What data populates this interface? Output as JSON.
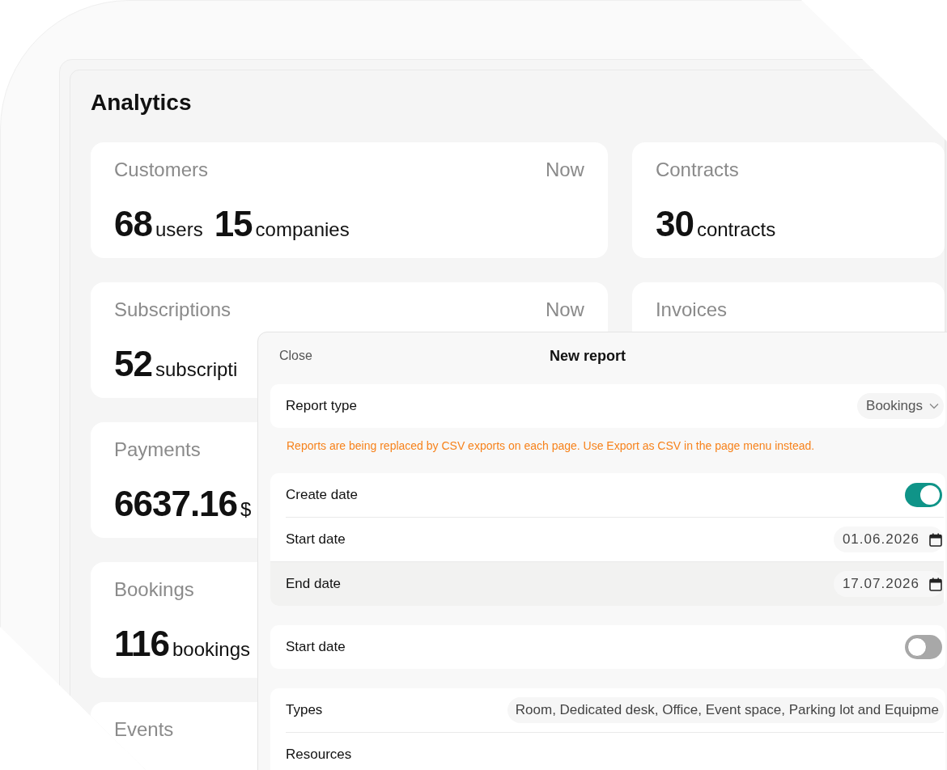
{
  "page": {
    "title": "Analytics"
  },
  "left_cards": [
    {
      "title": "Customers",
      "period": "Now",
      "figures": [
        {
          "value": "68",
          "unit": "users"
        },
        {
          "value": "15",
          "unit": "companies"
        }
      ]
    },
    {
      "title": "Subscriptions",
      "period": "Now",
      "figures": [
        {
          "value": "52",
          "unit": "subscripti"
        }
      ]
    },
    {
      "title": "Payments",
      "figures": [
        {
          "value": "6637.16",
          "unit": "$"
        }
      ]
    },
    {
      "title": "Bookings",
      "figures": [
        {
          "value": "116",
          "unit": "bookings"
        }
      ]
    },
    {
      "title": "Events"
    }
  ],
  "right_cards": [
    {
      "title": "Contracts",
      "figures": [
        {
          "value": "30",
          "unit": "contracts"
        }
      ]
    },
    {
      "title": "Invoices"
    }
  ],
  "dialog": {
    "close": "Close",
    "title": "New report",
    "sections": [
      {
        "rows": [
          {
            "kind": "select",
            "label": "Report type",
            "value": "Bookings"
          }
        ],
        "note": "Reports are being replaced by CSV exports on each page. Use Export as CSV in the page menu instead."
      },
      {
        "rows": [
          {
            "kind": "toggle",
            "label": "Create date",
            "on": true
          },
          {
            "kind": "date",
            "label": "Start date",
            "value": "01.06.2026",
            "highlighted": false
          },
          {
            "kind": "date",
            "label": "End date",
            "value": "17.07.2026",
            "highlighted": true
          }
        ]
      },
      {
        "rows": [
          {
            "kind": "toggle",
            "label": "Start date",
            "on": false
          }
        ]
      },
      {
        "rows": [
          {
            "kind": "chips",
            "label": "Types",
            "value": "Room, Dedicated desk, Office, Event space, Parking lot and Equipme"
          },
          {
            "kind": "plain",
            "label": "Resources"
          }
        ]
      }
    ]
  }
}
